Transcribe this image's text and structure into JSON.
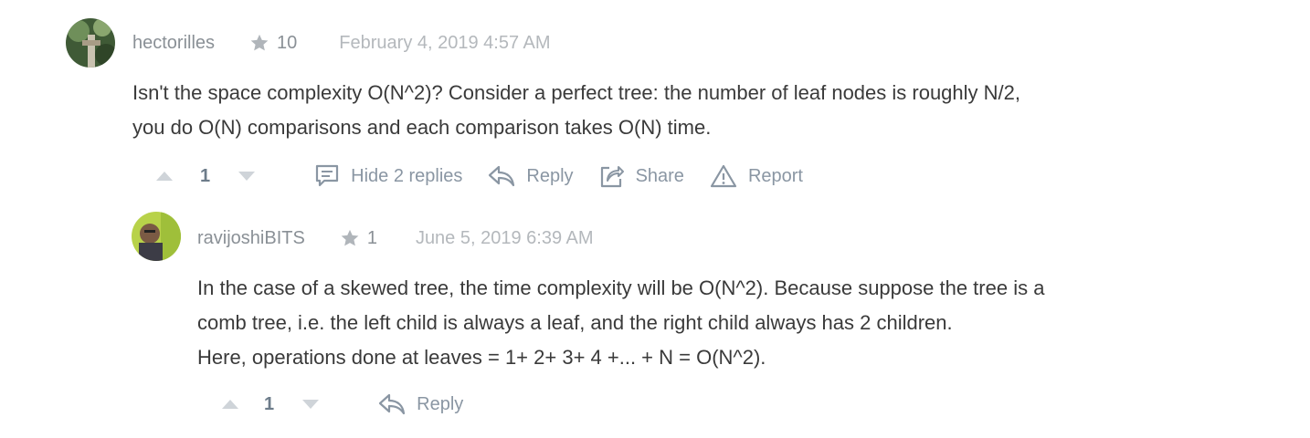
{
  "comments": [
    {
      "username": "hectorilles",
      "reputation": "10",
      "date": "February 4, 2019 4:57 AM",
      "body": [
        "Isn't the space complexity O(N^2)? Consider a perfect tree: the number of leaf nodes is roughly N/2,",
        "you do O(N) comparisons and each comparison takes O(N) time."
      ],
      "votes": "1",
      "actions": {
        "hide_replies": "Hide 2 replies",
        "reply": "Reply",
        "share": "Share",
        "report": "Report"
      }
    },
    {
      "username": "ravijoshiBITS",
      "reputation": "1",
      "date": "June 5, 2019 6:39 AM",
      "body": [
        "In the case of a skewed tree, the time complexity will be O(N^2). Because suppose the tree is a",
        "comb tree, i.e. the left child is always a leaf, and the right child always has 2 children.",
        "Here, operations done at leaves = 1+ 2+ 3+ 4 +... + N = O(N^2)."
      ],
      "votes": "1",
      "actions": {
        "reply": "Reply"
      }
    }
  ],
  "colors": {
    "icon": "#8a96a3",
    "star": "#b0b5ba",
    "text": "#3a3a3a"
  }
}
